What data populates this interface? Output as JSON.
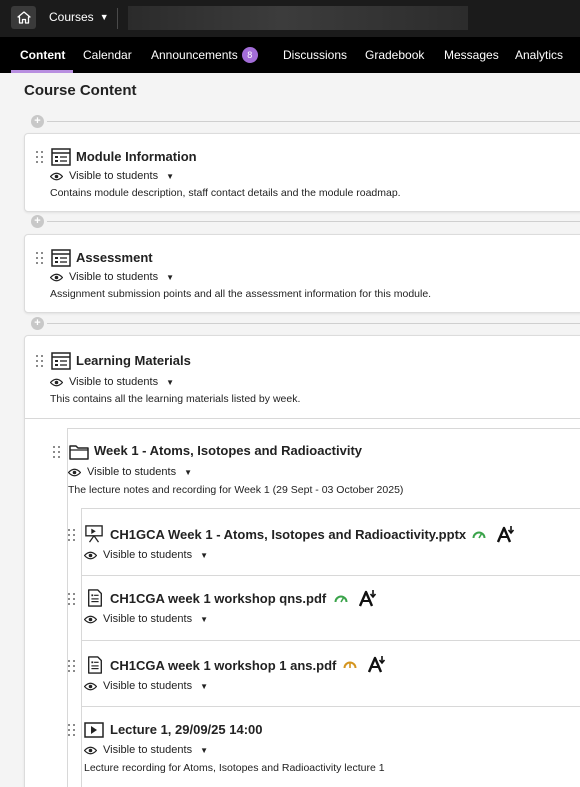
{
  "topbar": {
    "courses_label": "Courses",
    "home_icon": "home-icon"
  },
  "nav": {
    "tabs": [
      {
        "label": "Content",
        "active": true
      },
      {
        "label": "Calendar"
      },
      {
        "label": "Announcements",
        "badge": "8"
      },
      {
        "label": "Discussions"
      },
      {
        "label": "Gradebook"
      },
      {
        "label": "Messages"
      },
      {
        "label": "Analytics"
      }
    ]
  },
  "page": {
    "title": "Course Content"
  },
  "modules": [
    {
      "title": "Module Information",
      "visibility": "Visible to students",
      "description": "Contains module description, staff contact details and the module roadmap."
    },
    {
      "title": "Assessment",
      "visibility": "Visible to students",
      "description": "Assignment submission points and all the assessment information for this module."
    },
    {
      "title": "Learning Materials",
      "visibility": "Visible to students",
      "description": "This contains all the learning materials listed by week."
    }
  ],
  "week": {
    "title": "Week 1 - Atoms, Isotopes and Radioactivity",
    "visibility": "Visible to students",
    "description": "The lecture notes and recording for Week 1 (29 Sept - 03 October 2025)"
  },
  "files": [
    {
      "title": "CH1GCA Week 1 - Atoms, Isotopes and Radioactivity.pptx",
      "visibility": "Visible to students",
      "icon": "presentation-icon",
      "gauge_color": "#3aa34a"
    },
    {
      "title": "CH1CGA week 1 workshop qns.pdf",
      "visibility": "Visible to students",
      "icon": "document-icon",
      "gauge_color": "#3aa34a"
    },
    {
      "title": "CH1CGA week 1 workshop 1 ans.pdf",
      "visibility": "Visible to students",
      "icon": "document-icon",
      "gauge_color": "#d4951f"
    },
    {
      "title": "Lecture 1, 29/09/25 14:00",
      "visibility": "Visible to students",
      "icon": "video-icon",
      "description": "Lecture recording for Atoms, Isotopes and Radioactivity lecture 1"
    }
  ],
  "colors": {
    "accent": "#b88fe0",
    "badge": "#a36dd8",
    "topbar": "#1b1b1b",
    "nav": "#000000"
  }
}
